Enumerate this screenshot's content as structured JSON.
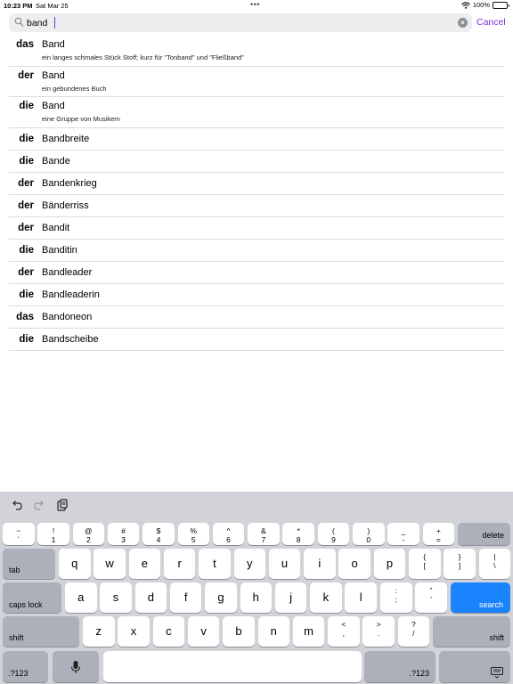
{
  "status_bar": {
    "time": "10:23 PM",
    "date": "Sat Mar 25",
    "battery": "100%",
    "battery_level": 1.0
  },
  "search": {
    "value": "band",
    "cancel_label": "Cancel"
  },
  "results": [
    {
      "article": "das",
      "word": "Band",
      "definition": "ein langes schmales Stück Stoff; kurz für \"Tonband\" und \"Fließband\""
    },
    {
      "article": "der",
      "word": "Band",
      "definition": "ein gebundenes Buch"
    },
    {
      "article": "die",
      "word": "Band",
      "definition": "eine Gruppe von Musikern"
    },
    {
      "article": "die",
      "word": "Bandbreite"
    },
    {
      "article": "die",
      "word": "Bande"
    },
    {
      "article": "der",
      "word": "Bandenkrieg"
    },
    {
      "article": "der",
      "word": "Bänderriss"
    },
    {
      "article": "der",
      "word": "Bandit"
    },
    {
      "article": "die",
      "word": "Banditin"
    },
    {
      "article": "der",
      "word": "Bandleader"
    },
    {
      "article": "die",
      "word": "Bandleaderin"
    },
    {
      "article": "das",
      "word": "Bandoneon"
    },
    {
      "article": "die",
      "word": "Bandscheibe"
    }
  ],
  "keyboard": {
    "number_row": [
      {
        "top": "~",
        "bottom": "`"
      },
      {
        "top": "!",
        "bottom": "1"
      },
      {
        "top": "@",
        "bottom": "2"
      },
      {
        "top": "#",
        "bottom": "3"
      },
      {
        "top": "$",
        "bottom": "4"
      },
      {
        "top": "%",
        "bottom": "5"
      },
      {
        "top": "^",
        "bottom": "6"
      },
      {
        "top": "&",
        "bottom": "7"
      },
      {
        "top": "*",
        "bottom": "8"
      },
      {
        "top": "(",
        "bottom": "9"
      },
      {
        "top": ")",
        "bottom": "0"
      },
      {
        "top": "_",
        "bottom": "-"
      },
      {
        "top": "+",
        "bottom": "="
      }
    ],
    "delete_label": "delete",
    "tab_label": "tab",
    "row_q": [
      "q",
      "w",
      "e",
      "r",
      "t",
      "y",
      "u",
      "i",
      "o",
      "p"
    ],
    "row_q_symbols": [
      {
        "top": "{",
        "bottom": "["
      },
      {
        "top": "}",
        "bottom": "]"
      },
      {
        "top": "|",
        "bottom": "\\"
      }
    ],
    "caps_label": "caps lock",
    "row_a": [
      "a",
      "s",
      "d",
      "f",
      "g",
      "h",
      "j",
      "k",
      "l"
    ],
    "row_a_symbols": [
      {
        "top": ":",
        "bottom": ";"
      },
      {
        "top": "”",
        "bottom": "’"
      }
    ],
    "search_label": "search",
    "shift_label": "shift",
    "row_z": [
      "z",
      "x",
      "c",
      "v",
      "b",
      "n",
      "m"
    ],
    "row_z_symbols": [
      {
        "top": "<",
        "bottom": ","
      },
      {
        "top": ">",
        "bottom": "."
      },
      {
        "top": "?",
        "bottom": "/"
      }
    ],
    "numbers_label": ".?123",
    "icons": [
      "undo-icon",
      "redo-icon",
      "clipboard-icon",
      "microphone-icon",
      "keyboard-hide-icon"
    ],
    "accent_color": "#1a84ff"
  }
}
